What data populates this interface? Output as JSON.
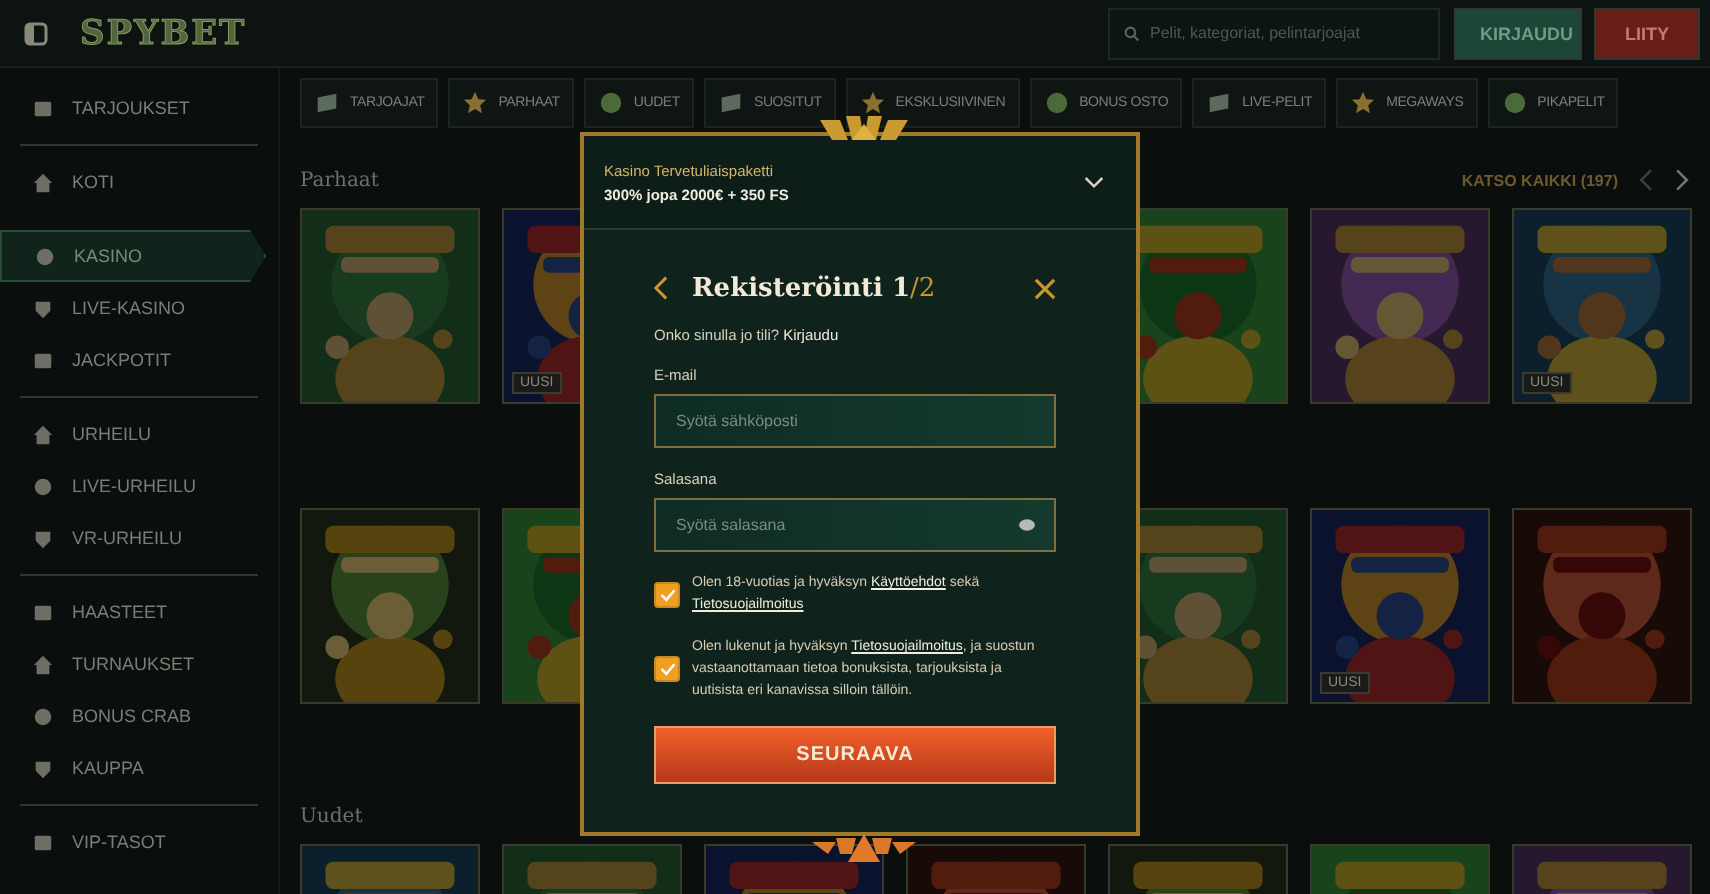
{
  "header": {
    "logo": "SPYBET",
    "search": {
      "placeholder": "Pelit, kategoriat, pelintarjoajat"
    },
    "buttons": [
      {
        "label": "KIRJAUDU",
        "kind": "login"
      },
      {
        "label": "LIITY",
        "kind": "join"
      }
    ]
  },
  "sidebar": {
    "groups": [
      {
        "separated": false,
        "items": [
          {
            "label": "TARJOUKSET",
            "selected": false
          }
        ]
      },
      {
        "separated": true,
        "items": [
          {
            "label": "KOTI",
            "selected": false
          }
        ]
      },
      {
        "separated": false,
        "items": [
          {
            "label": "KASINO",
            "selected": true
          },
          {
            "label": "LIVE-KASINO",
            "selected": false
          },
          {
            "label": "JACKPOTIT",
            "selected": false
          }
        ]
      },
      {
        "separated": true,
        "items": [
          {
            "label": "URHEILU",
            "selected": false
          },
          {
            "label": "LIVE-URHEILU",
            "selected": false
          },
          {
            "label": "VR-URHEILU",
            "selected": false
          }
        ]
      },
      {
        "separated": true,
        "items": [
          {
            "label": "HAASTEET",
            "selected": false
          },
          {
            "label": "TURNAUKSET",
            "selected": false
          },
          {
            "label": "BONUS CRAB",
            "selected": false
          },
          {
            "label": "KAUPPA",
            "selected": false
          }
        ]
      },
      {
        "separated": true,
        "items": [
          {
            "label": "VIP-TASOT",
            "selected": false
          }
        ]
      }
    ]
  },
  "categories": [
    {
      "label": "TARJOAJAT"
    },
    {
      "label": "PARHAAT"
    },
    {
      "label": "UUDET"
    },
    {
      "label": "SUOSITUT"
    },
    {
      "label": "EKSKLUSIIVINEN"
    },
    {
      "label": "BONUS OSTO"
    },
    {
      "label": "LIVE-PELIT"
    },
    {
      "label": "MEGAWAYS"
    },
    {
      "label": "PIKAPELIT"
    }
  ],
  "sections": [
    {
      "title": "Parhaat",
      "view_all": "KATSO KAIKKI (197)",
      "rows": [
        [
          {},
          {
            "badge": "UUSI"
          },
          {},
          {},
          {
            "badge": "UUSI"
          }
        ],
        [
          {},
          {},
          {},
          {
            "badge": "UUSI"
          },
          {}
        ]
      ]
    },
    {
      "title": "Uudet",
      "rows": [
        [
          {},
          {},
          {},
          {},
          {},
          {},
          {}
        ]
      ]
    }
  ],
  "dialog": {
    "promo": {
      "title": "Kasino Tervetuliaispaketti",
      "offer": "300% jopa 2000€ + 350 FS"
    },
    "title": "Rekisteröinti 1",
    "step_total": "/2",
    "login_prompt": {
      "text": "Onko sinulla jo tili? ",
      "link": "Kirjaudu"
    },
    "fields": [
      {
        "label": "E-mail",
        "placeholder": "Syötä sähköposti",
        "kind": "email"
      },
      {
        "label": "Salasana",
        "placeholder": "Syötä salasana",
        "kind": "password"
      }
    ],
    "consents": [
      {
        "checked": true,
        "parts": [
          {
            "text": "Olen 18-vuotias ja hyväksyn "
          },
          {
            "link": "Käyttöehdot"
          },
          {
            "text": " sekä "
          },
          {
            "link": "Tietosuojailmoitus"
          }
        ]
      },
      {
        "checked": true,
        "parts": [
          {
            "text": "Olen lukenut ja hyväksyn "
          },
          {
            "link": "Tietosuojailmoitus"
          },
          {
            "text": ", ja suostun vastaanottamaan tietoa bonuksista, tarjouksista ja uutisista eri kanavissa silloin tällöin."
          }
        ]
      }
    ],
    "submit": "SEURAAVA"
  }
}
